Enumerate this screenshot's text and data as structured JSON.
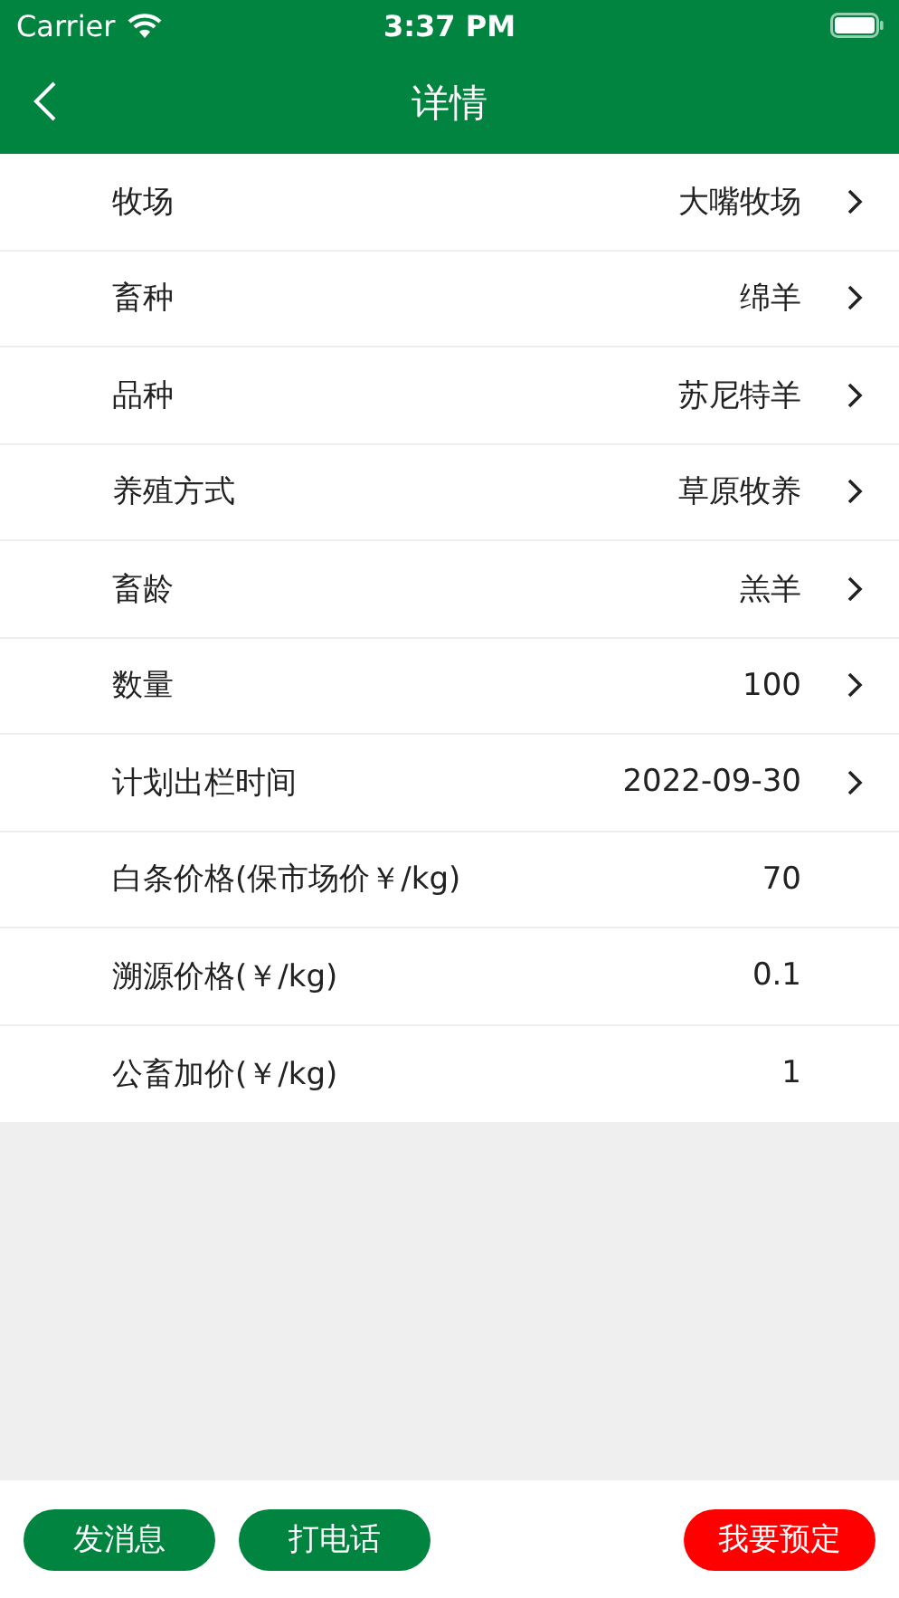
{
  "status_bar": {
    "carrier": "Carrier",
    "time": "3:37 PM"
  },
  "nav": {
    "title": "详情"
  },
  "rows": [
    {
      "label": "牧场",
      "value": "大嘴牧场",
      "chevron": true
    },
    {
      "label": "畜种",
      "value": "绵羊",
      "chevron": true
    },
    {
      "label": "品种",
      "value": "苏尼特羊",
      "chevron": true
    },
    {
      "label": "养殖方式",
      "value": "草原牧养",
      "chevron": true
    },
    {
      "label": "畜龄",
      "value": "羔羊",
      "chevron": true
    },
    {
      "label": "数量",
      "value": "100",
      "chevron": true
    },
    {
      "label": "计划出栏时间",
      "value": "2022-09-30",
      "chevron": true
    },
    {
      "label": "白条价格(保市场价￥/kg)",
      "value": "70",
      "chevron": false
    },
    {
      "label": "溯源价格(￥/kg)",
      "value": "0.1",
      "chevron": false
    },
    {
      "label": "公畜加价(￥/kg)",
      "value": "1",
      "chevron": false
    }
  ],
  "buttons": [
    {
      "label": "发消息",
      "kind": "primary"
    },
    {
      "label": "打电话",
      "kind": "primary"
    },
    {
      "label": "我要预定",
      "kind": "danger"
    }
  ]
}
